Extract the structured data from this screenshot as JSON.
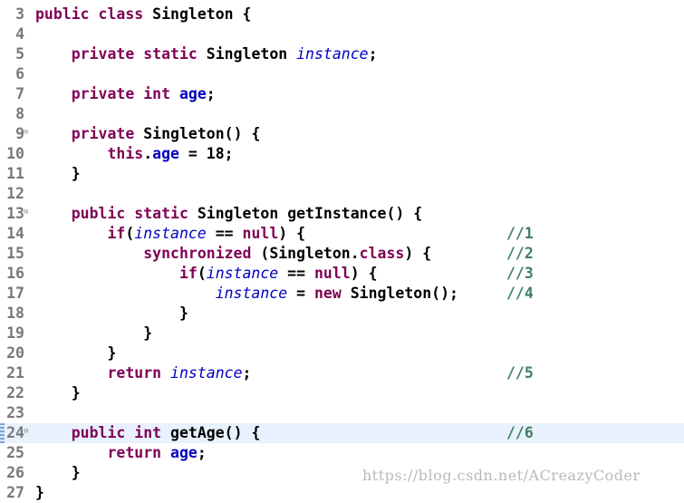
{
  "editor": {
    "lines": [
      {
        "no": "3",
        "code": "public class Singleton {"
      },
      {
        "no": "4",
        "code": ""
      },
      {
        "no": "5",
        "code": "    private static Singleton instance;"
      },
      {
        "no": "6",
        "code": ""
      },
      {
        "no": "7",
        "code": "    private int age;"
      },
      {
        "no": "8",
        "code": ""
      },
      {
        "no": "9",
        "code": "    private Singleton() {"
      },
      {
        "no": "10",
        "code": "        this.age = 18;"
      },
      {
        "no": "11",
        "code": "    }"
      },
      {
        "no": "12",
        "code": ""
      },
      {
        "no": "13",
        "code": "    public static Singleton getInstance() {"
      },
      {
        "no": "14",
        "code": "        if(instance == null) {",
        "comment": "//1"
      },
      {
        "no": "15",
        "code": "            synchronized (Singleton.class) {",
        "comment": "//2"
      },
      {
        "no": "16",
        "code": "                if(instance == null) {",
        "comment": "//3"
      },
      {
        "no": "17",
        "code": "                    instance = new Singleton();",
        "comment": "//4"
      },
      {
        "no": "18",
        "code": "                }"
      },
      {
        "no": "19",
        "code": "            }"
      },
      {
        "no": "20",
        "code": "        }"
      },
      {
        "no": "21",
        "code": "        return instance;",
        "comment": "//5"
      },
      {
        "no": "22",
        "code": "    }"
      },
      {
        "no": "23",
        "code": ""
      },
      {
        "no": "24",
        "code": "    public int getAge() {",
        "comment": "//6"
      },
      {
        "no": "25",
        "code": "        return age;"
      },
      {
        "no": "26",
        "code": "    }"
      },
      {
        "no": "27",
        "code": "}"
      }
    ],
    "fold_lines": [
      "9",
      "13",
      "24"
    ],
    "current_line": "24",
    "keywords": [
      "public",
      "class",
      "private",
      "static",
      "int",
      "this",
      "if",
      "null",
      "synchronized",
      "return",
      "new"
    ],
    "fields": [
      "age"
    ],
    "static_fields": [
      "instance"
    ]
  },
  "watermark": "https://blog.csdn.net/ACreazyCoder",
  "colors": {
    "keyword": "#7f0055",
    "field": "#0000c0",
    "comment": "#3f7f5f",
    "line_number": "#787878",
    "current_line_bg": "#e8f2fe"
  }
}
